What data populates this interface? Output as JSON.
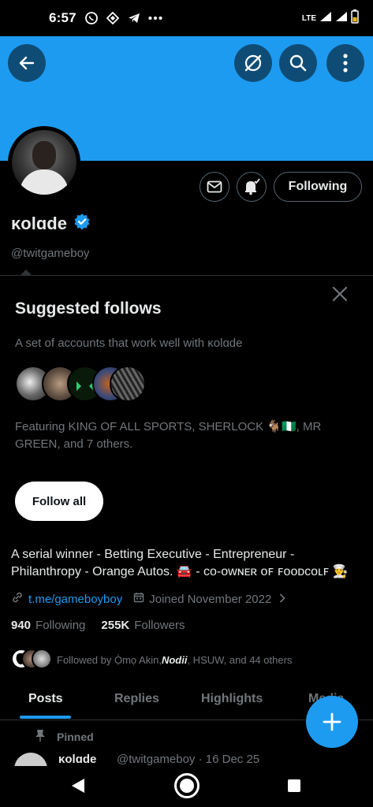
{
  "status_bar": {
    "time": "6:57",
    "network": "LTE",
    "icons": [
      "whatsapp-icon",
      "binance-icon",
      "telegram-icon",
      "more-dots-icon",
      "signal-icon",
      "battery-icon"
    ]
  },
  "header": {
    "back_icon": "arrow-left-icon",
    "grok_icon": "grok-icon",
    "search_icon": "search-icon",
    "more_icon": "more-vertical-icon",
    "banner_color": "#1d9bf0"
  },
  "profile": {
    "name": "κolɑde",
    "verified": true,
    "handle": "@twitgameboy",
    "following_button": "Following",
    "message_icon": "envelope-icon",
    "notify_icon": "bell-check-icon"
  },
  "suggested": {
    "title": "Suggested follows",
    "subtitle": "A set of accounts that work well with κolɑde",
    "featuring": "Featuring KING OF ALL SPORTS, SHERLOCK 🐐🇳🇬, MR GREEN, and 7 others.",
    "follow_all": "Follow all"
  },
  "bio": {
    "text": "A serial winner - Betting Executive - Entrepreneur - Philanthropy - Orange Autos. 🚘 - ᴄᴏ-ᴏᴡɴᴇʀ ᴏꜰ ꜰᴏᴏᴅᴄᴏʟꜰ 👨‍🍳",
    "link": "t.me/gameboyboy",
    "joined": "Joined November 2022",
    "following_count": "940",
    "following_label": "Following",
    "followers_count": "255K",
    "followers_label": "Followers",
    "followed_by_prefix": "Followed by Ọ̀mọ Akin, ",
    "followed_by_em": "Nodii",
    "followed_by_suffix": ", HSUW, and 44 others"
  },
  "tabs": [
    {
      "label": "Posts",
      "active": true
    },
    {
      "label": "Replies",
      "active": false
    },
    {
      "label": "Highlights",
      "active": false
    },
    {
      "label": "Media",
      "active": false
    }
  ],
  "pinned": {
    "label": "Pinned",
    "author": "κolɑde",
    "meta": "@twitgameboy · 16 Dec 25"
  },
  "fab_icon": "plus-icon",
  "nav": [
    "back-triangle-icon",
    "home-circle-icon",
    "recents-square-icon"
  ]
}
